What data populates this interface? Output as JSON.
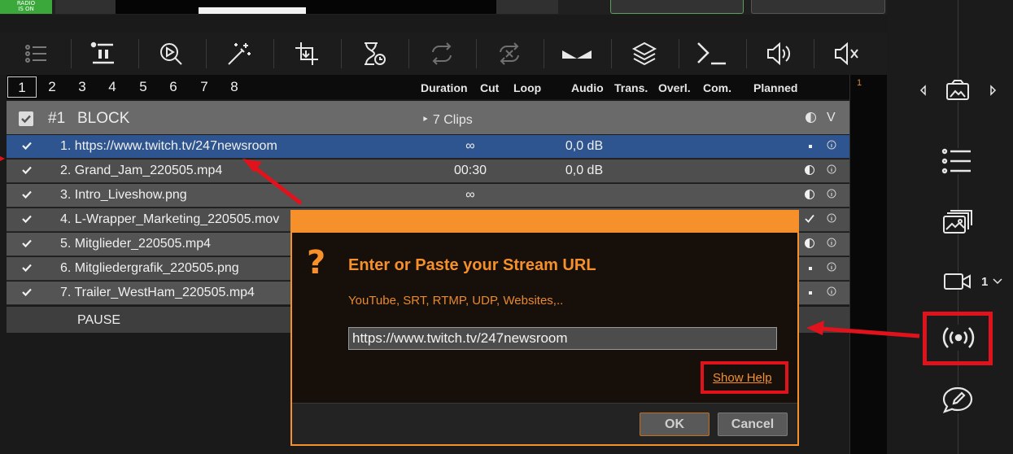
{
  "top": {
    "audio_badge": "RADIO\nIS ON"
  },
  "tabs": [
    "1",
    "2",
    "3",
    "4",
    "5",
    "6",
    "7",
    "8"
  ],
  "columns": {
    "duration": "Duration",
    "cut": "Cut",
    "loop": "Loop",
    "audio": "Audio",
    "trans": "Trans.",
    "overl": "Overl.",
    "com": "Com.",
    "planned": "Planned"
  },
  "block": {
    "number": "#1",
    "name": "BLOCK",
    "clips": "‣ 7 Clips",
    "collapse": "V"
  },
  "rows": [
    {
      "label": "1. https://www.twitch.tv/247newsroom",
      "duration": "∞",
      "audio": "0,0 dB",
      "selected": true,
      "indicator": "dot"
    },
    {
      "label": "2. Grand_Jam_220505.mp4",
      "duration": "00:30",
      "audio": "0,0 dB",
      "selected": false,
      "indicator": "half"
    },
    {
      "label": "3. Intro_Liveshow.png",
      "duration": "∞",
      "audio": "",
      "selected": false,
      "indicator": "half"
    },
    {
      "label": "4. L-Wrapper_Marketing_220505.mov",
      "duration": "",
      "audio": "",
      "selected": false,
      "indicator": "check"
    },
    {
      "label": "5. Mitglieder_220505.mp4",
      "duration": "",
      "audio": "",
      "selected": false,
      "indicator": "half"
    },
    {
      "label": "6. Mitgliedergrafik_220505.png",
      "duration": "",
      "audio": "",
      "selected": false,
      "indicator": "dot"
    },
    {
      "label": "7. Trailer_WestHam_220505.mp4",
      "duration": "",
      "audio": "",
      "selected": false,
      "indicator": "dot"
    }
  ],
  "pause_label": "PAUSE",
  "gutter_number": "1",
  "side": {
    "camera_count": "1"
  },
  "dialog": {
    "question": "?",
    "heading": "Enter or Paste your Stream URL",
    "subtitle": "YouTube, SRT, RTMP, UDP, Websites,..",
    "url_value": "https://www.twitch.tv/247newsroom",
    "help_link": "Show Help",
    "ok_label": "OK",
    "cancel_label": "Cancel"
  },
  "colors": {
    "accent": "#f5902a",
    "selection": "#2f5590",
    "annotation": "#e0121b",
    "radio_badge": "#3aa83a"
  }
}
